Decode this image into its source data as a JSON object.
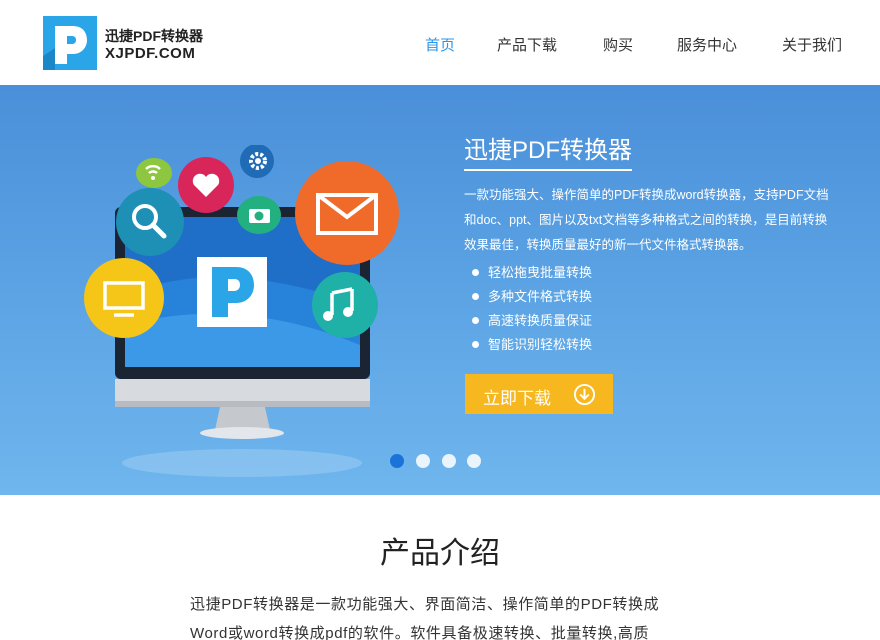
{
  "header": {
    "logo_cn": "迅捷PDF转换器",
    "logo_en": "XJPDF.COM"
  },
  "nav": [
    {
      "label": "首页",
      "active": true
    },
    {
      "label": "产品下载",
      "active": false
    },
    {
      "label": "购买",
      "active": false
    },
    {
      "label": "服务中心",
      "active": false
    },
    {
      "label": "关于我们",
      "active": false
    }
  ],
  "banner": {
    "title": "迅捷PDF转换器",
    "desc": "一款功能强大、操作简单的PDF转换成word转换器，支持PDF文档和doc、ppt、图片以及txt文档等多种格式之间的转换，是目前转换效果最佳，转换质量最好的新一代文件格式转换器。",
    "features": [
      "轻松拖曳批量转换",
      "多种文件格式转换",
      "高速转换质量保证",
      "智能识别轻松转换"
    ],
    "download_label": "立即下载",
    "carousel_count": 4,
    "carousel_active": 0
  },
  "intro": {
    "title": "产品介绍",
    "text": "迅捷PDF转换器是一款功能强大、界面简洁、操作简单的PDF转换成Word或word转换成pdf的软件。软件具备极速转换、批量转换,高质"
  },
  "colors": {
    "nav_active": "#2b95e9",
    "banner_top": "#4a8fd9",
    "banner_bottom": "#6fb6ee",
    "download_button": "#f7b81f",
    "carousel_active": "#1a73d9"
  },
  "icons": [
    "logo-mark",
    "wifi-bubble-icon",
    "heart-bubble-icon",
    "gear-bubble-icon",
    "search-bubble-icon",
    "camera-bubble-icon",
    "mail-bubble-icon",
    "monitor-bubble-icon",
    "music-bubble-icon",
    "monitor-illustration",
    "download-arrow-icon"
  ]
}
